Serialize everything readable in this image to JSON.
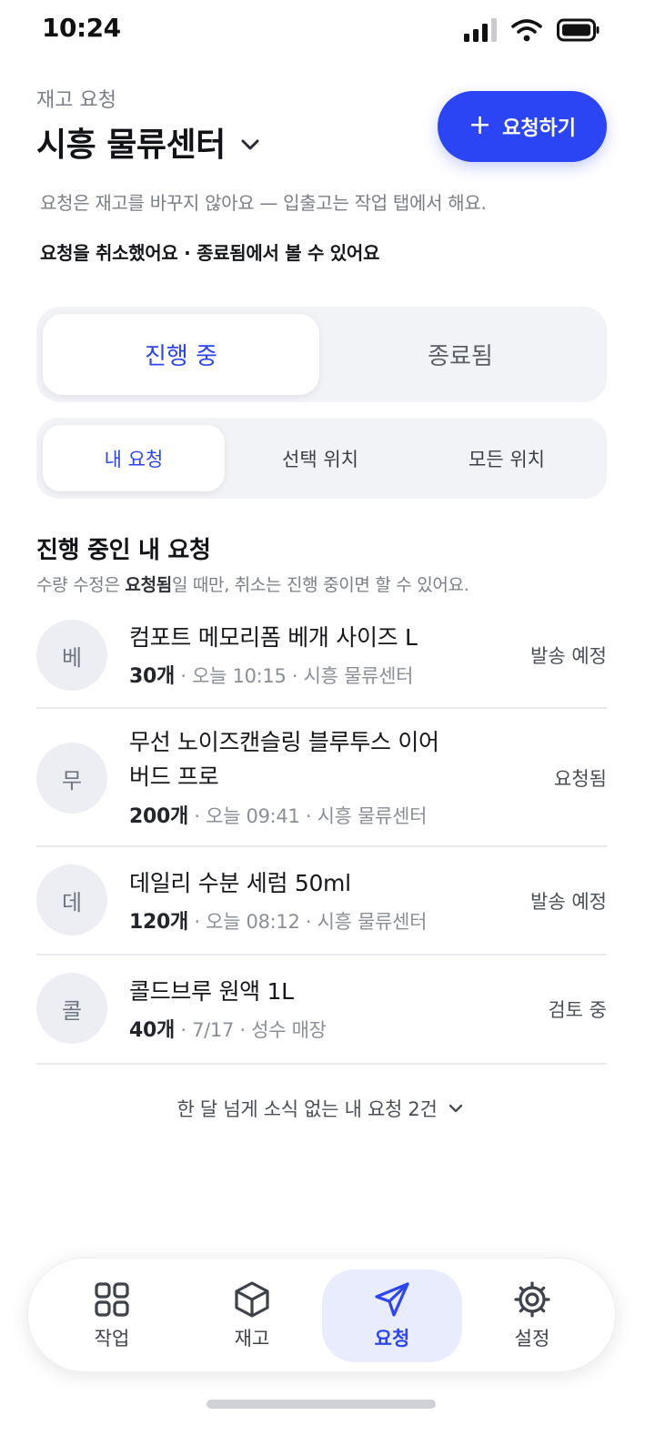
{
  "status_bar": {
    "time": "10:24"
  },
  "header": {
    "eyebrow": "재고 요청",
    "title": "시흥 물류센터",
    "new_request_label": "요청하기",
    "info": "요청은 재고를 바꾸지 않아요 — 입출고는 작업 탭에서 해요.",
    "notice": "요청을 취소했어요 · 종료됨에서 볼 수 있어요"
  },
  "status_tabs": [
    {
      "label": "진행 중",
      "active": true
    },
    {
      "label": "종료됨",
      "active": false
    }
  ],
  "scope_tabs": [
    {
      "label": "내 요청",
      "active": true
    },
    {
      "label": "선택 위치",
      "active": false
    },
    {
      "label": "모든 위치",
      "active": false
    }
  ],
  "section": {
    "title": "진행 중인 내 요청",
    "desc_prefix": "수량 수정은 ",
    "desc_bold": "요청됨",
    "desc_suffix": "일 때만, 취소는 진행 중이면 할 수 있어요."
  },
  "requests": [
    {
      "initial": "베",
      "name": "컴포트 메모리폼 베개 사이즈 L",
      "qty": "30개",
      "details": " · 오늘 10:15 · 시흥 물류센터",
      "status": "발송 예정"
    },
    {
      "initial": "무",
      "name": "무선 노이즈캔슬링 블루투스 이어버드 프로",
      "qty": "200개",
      "details": " · 오늘 09:41 · 시흥 물류센터",
      "status": "요청됨"
    },
    {
      "initial": "데",
      "name": "데일리 수분 세럼 50ml",
      "qty": "120개",
      "details": " · 오늘 08:12 · 시흥 물류센터",
      "status": "발송 예정"
    },
    {
      "initial": "콜",
      "name": "콜드브루 원액 1L",
      "qty": "40개",
      "details": " · 7/17 · 성수 매장",
      "status": "검토 중"
    }
  ],
  "more": {
    "label": "한 달 넘게 소식 없는 내 요청 2건"
  },
  "bottom_nav": [
    {
      "label": "작업",
      "icon": "grid-icon",
      "active": false
    },
    {
      "label": "재고",
      "icon": "box-icon",
      "active": false
    },
    {
      "label": "요청",
      "icon": "send-icon",
      "active": true
    },
    {
      "label": "설정",
      "icon": "gear-icon",
      "active": false
    }
  ],
  "colors": {
    "accent": "#2b45f5",
    "accent_soft": "#e8ecfd",
    "surface": "#f2f3f7"
  }
}
